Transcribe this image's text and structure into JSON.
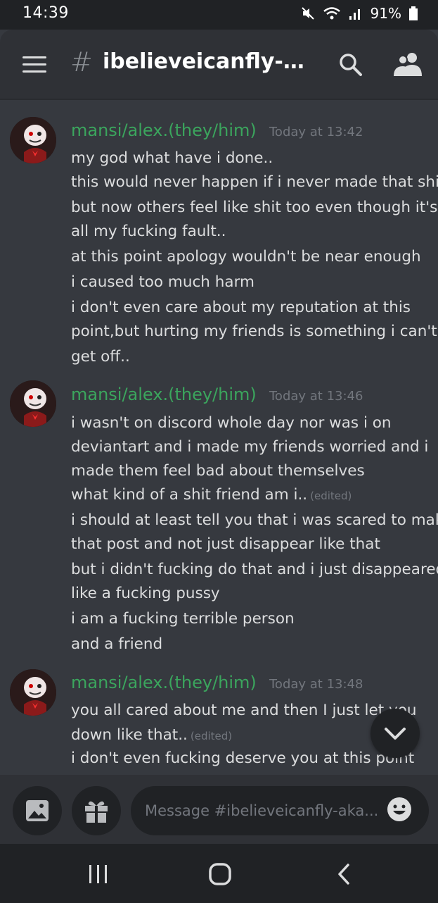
{
  "status_bar": {
    "time": "14:39",
    "battery": "91%"
  },
  "header": {
    "channel": "ibelieveicanfly-ak..."
  },
  "messages": [
    {
      "author": "mansi/alex.(they/him)",
      "timestamp": "Today at 13:42",
      "lines": [
        {
          "text": "my god what have i done.."
        },
        {
          "text": "this would never happen if i never made that shit"
        },
        {
          "text": "but now others feel like shit too even though it's"
        },
        {
          "text": "all my fucking fault.."
        },
        {
          "text": "at this point apology wouldn't be near enough"
        },
        {
          "text": "i caused too much harm"
        },
        {
          "text": "i don't even care about my reputation at this"
        },
        {
          "text": "point,but hurting my friends is something i can't"
        },
        {
          "text": "get off.."
        }
      ]
    },
    {
      "author": "mansi/alex.(they/him)",
      "timestamp": "Today at 13:46",
      "lines": [
        {
          "text": "i wasn't on discord whole day nor was i on"
        },
        {
          "text": "deviantart and i made my friends worried and i"
        },
        {
          "text": "made them feel bad about themselves"
        },
        {
          "text": "what kind of a shit friend am i..",
          "edited": "(edited)"
        },
        {
          "text": "i should at least tell you that i was scared to make"
        },
        {
          "text": "that post and not just disappear like that"
        },
        {
          "text": "but i didn't fucking do that and i just disappeared"
        },
        {
          "text": "like a fucking pussy"
        },
        {
          "text": "i am a fucking terrible person"
        },
        {
          "text": "and a friend"
        }
      ]
    },
    {
      "author": "mansi/alex.(they/him)",
      "timestamp": "Today at 13:48",
      "lines": [
        {
          "text": "you all cared about me and then I just let you"
        },
        {
          "text": "down like that..",
          "edited": "(edited)"
        },
        {
          "text": "i don't even fucking deserve you at this point"
        }
      ]
    }
  ],
  "composer": {
    "placeholder": "Message #ibelieveicanfly-aka..."
  },
  "colors": {
    "author": "#3ba55d",
    "background": "#36393f",
    "header": "#2f3136",
    "dark": "#202225"
  },
  "icons": [
    "menu-icon",
    "hash-icon",
    "search-icon",
    "members-icon",
    "scroll-down-icon",
    "image-icon",
    "gift-icon",
    "emoji-icon",
    "recents-icon",
    "home-icon",
    "back-icon"
  ]
}
